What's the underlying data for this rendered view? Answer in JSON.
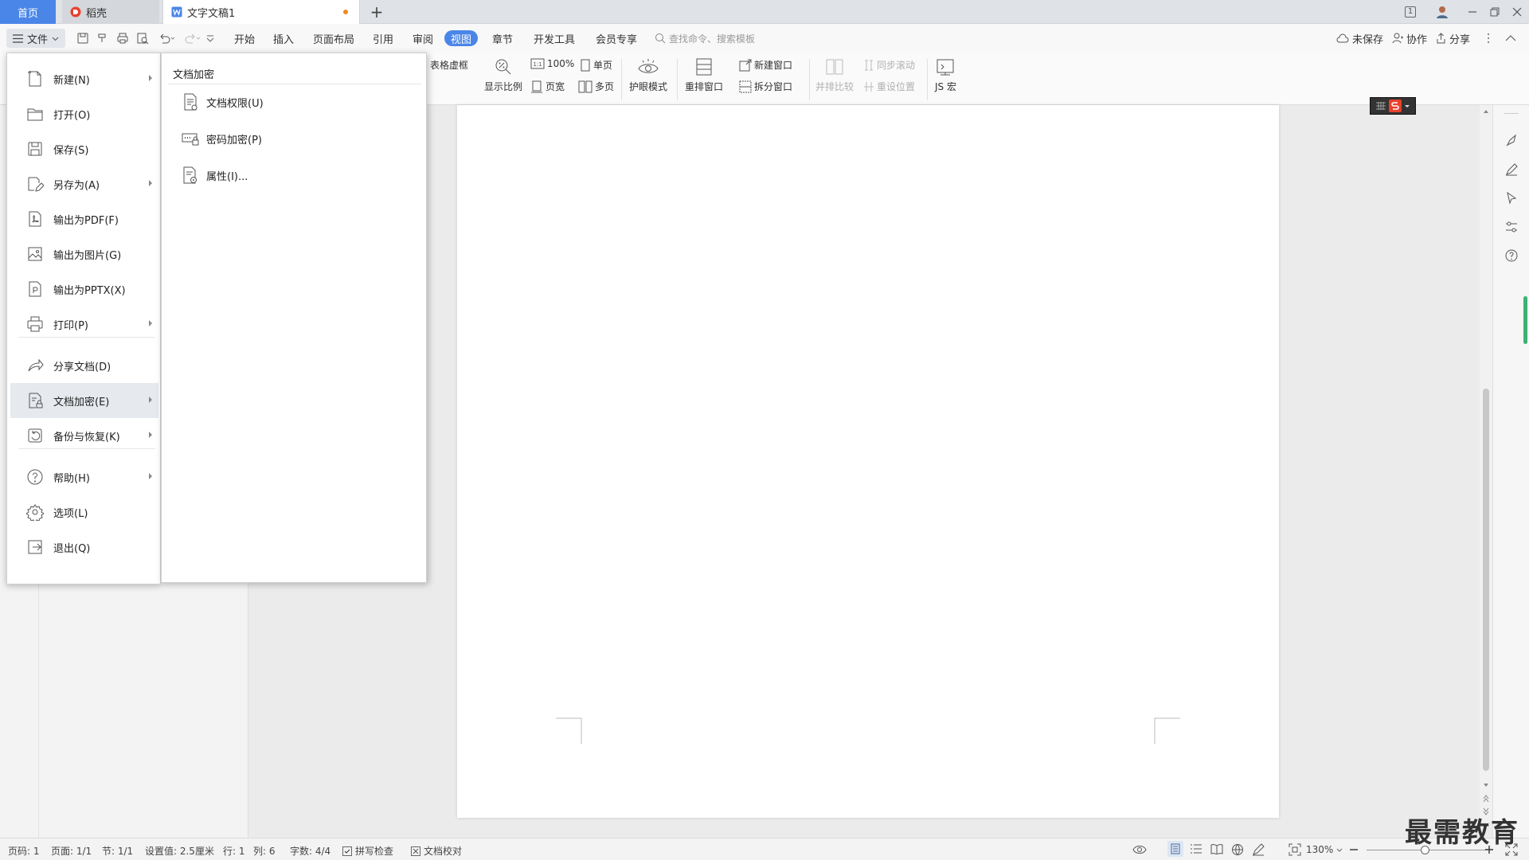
{
  "tabs": {
    "home": "首页",
    "daoke": "稻壳",
    "doc": "文字文稿1"
  },
  "window": {
    "badge": "1"
  },
  "toolbar": {
    "file_label": "文件",
    "menus": [
      "开始",
      "插入",
      "页面布局",
      "引用",
      "审阅",
      "视图",
      "章节",
      "开发工具",
      "会员专享"
    ],
    "search_placeholder": "查找命令、搜索模板",
    "unsaved": "未保存",
    "collab": "协作",
    "share": "分享"
  },
  "ribbon": {
    "table_frame": "表格虚框",
    "zoom_ratio": "显示比例",
    "zoom_100": "100%",
    "single_page": "单页",
    "page_width": "页宽",
    "multi_page": "多页",
    "eye_mode": "护眼模式",
    "rearrange": "重排窗口",
    "new_window": "新建窗口",
    "split_window": "拆分窗口",
    "side_by_side": "并排比较",
    "sync_scroll": "同步滚动",
    "reset_pos": "重设位置",
    "js_macro": "JS 宏"
  },
  "file_menu": [
    {
      "label": "新建(N)",
      "icon": "new-doc-icon",
      "arrow": true
    },
    {
      "label": "打开(O)",
      "icon": "folder-icon",
      "arrow": false
    },
    {
      "label": "保存(S)",
      "icon": "save-icon",
      "arrow": false
    },
    {
      "label": "另存为(A)",
      "icon": "save-as-icon",
      "arrow": true
    },
    {
      "label": "输出为PDF(F)",
      "icon": "pdf-icon",
      "arrow": false
    },
    {
      "label": "输出为图片(G)",
      "icon": "image-icon",
      "arrow": false
    },
    {
      "label": "输出为PPTX(X)",
      "icon": "pptx-icon",
      "arrow": false
    },
    {
      "label": "打印(P)",
      "icon": "print-icon",
      "arrow": true
    },
    {
      "label": "分享文档(D)",
      "icon": "share-icon",
      "arrow": false
    },
    {
      "label": "文档加密(E)",
      "icon": "encrypt-icon",
      "arrow": true
    },
    {
      "label": "备份与恢复(K)",
      "icon": "backup-icon",
      "arrow": true
    },
    {
      "label": "帮助(H)",
      "icon": "help-icon",
      "arrow": true
    },
    {
      "label": "选项(L)",
      "icon": "gear-icon",
      "arrow": false
    },
    {
      "label": "退出(Q)",
      "icon": "exit-icon",
      "arrow": false
    }
  ],
  "submenu": {
    "title": "文档加密",
    "items": [
      {
        "label": "文档权限(U)",
        "icon": "doc-permission-icon"
      },
      {
        "label": "密码加密(P)",
        "icon": "password-lock-icon"
      },
      {
        "label": "属性(I)...",
        "icon": "properties-icon"
      }
    ]
  },
  "status": {
    "page_code": "页码: 1",
    "page": "页面: 1/1",
    "section": "节: 1/1",
    "setting": "设置值: 2.5厘米",
    "row": "行: 1",
    "col": "列: 6",
    "words": "字数: 4/4",
    "spell": "拼写检查",
    "proof": "文档校对",
    "zoom": "130%"
  },
  "watermark": "最需教育"
}
